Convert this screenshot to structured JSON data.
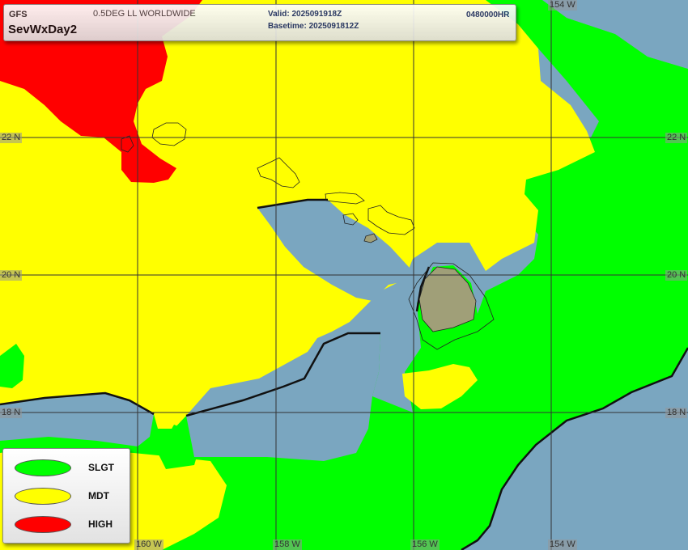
{
  "header": {
    "model": "GFS",
    "grid": "0.5DEG LL WORLDWIDE",
    "product": "SevWxDay2",
    "valid": "Valid: 2025091918Z",
    "basetime": "Basetime: 2025091812Z",
    "forecast_hour": "0480000HR"
  },
  "legend": {
    "items": [
      {
        "label": "SLGT",
        "color": "#00ff00"
      },
      {
        "label": "MDT",
        "color": "#ffff00"
      },
      {
        "label": "HIGH",
        "color": "#ff0000"
      }
    ]
  },
  "graticule": {
    "lon_labels": [
      "160 W",
      "158 W",
      "156 W",
      "154 W"
    ],
    "lat_labels": [
      "22 N",
      "20 N",
      "18 N"
    ]
  },
  "colors": {
    "ocean": "#7aa6c0",
    "land": "#a09f78",
    "slight": "#00ff00",
    "moderate": "#ffff00",
    "high": "#ff0000"
  }
}
